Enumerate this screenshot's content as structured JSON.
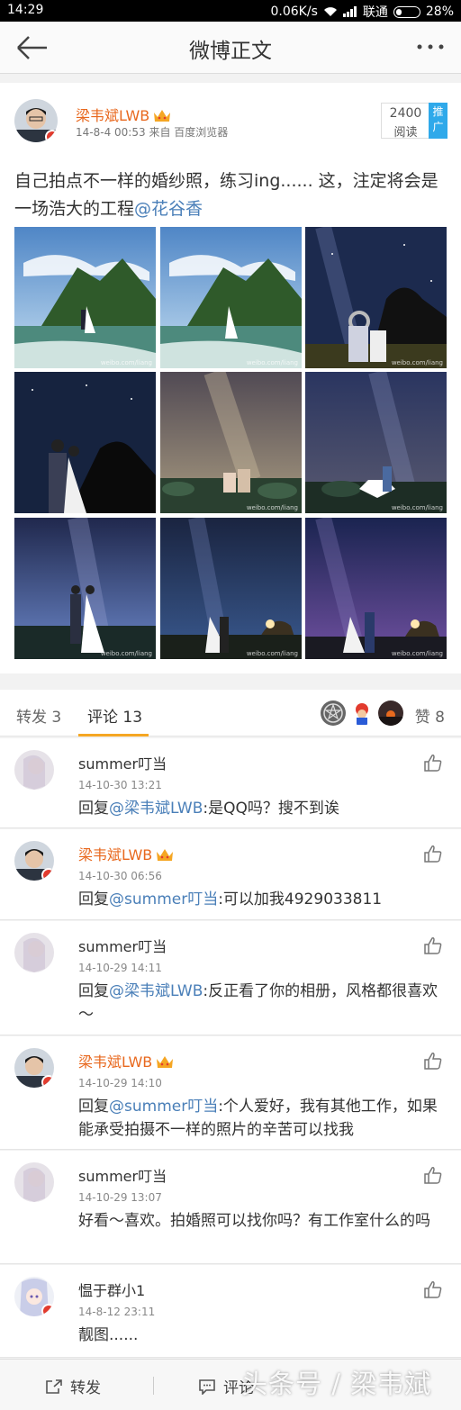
{
  "status": {
    "time": "14:29",
    "speed": "0.06K/s",
    "carrier": "联通",
    "battery": "28%",
    "battery_level": 0.28
  },
  "nav": {
    "title": "微博正文"
  },
  "post": {
    "author": "梁韦斌LWB",
    "datetime": "14-8-4 00:53",
    "source": "来自 百度浏览器",
    "read_count": "2400",
    "read_label": "阅读",
    "promo_label": "推广",
    "text": "自己拍点不一样的婚纱照，练习ing...... 这，注定将会是一场浩大的工程",
    "mention": "@花谷香",
    "photo_watermark": "weibo.com/liang"
  },
  "tabs": {
    "reposts": "转发 3",
    "comments": "评论 13",
    "likes": "赞 8"
  },
  "comments": [
    {
      "name": "summer叮当",
      "time": "14-10-30 13:21",
      "prefix": "回复",
      "mention": "@梁韦斌LWB",
      "text": ":是QQ吗？搜不到诶"
    },
    {
      "name": "梁韦斌LWB",
      "time": "14-10-30 06:56",
      "prefix": "回复",
      "mention": "@summer叮当",
      "text": ":可以加我4929033811"
    },
    {
      "name": "summer叮当",
      "time": "14-10-29 14:11",
      "prefix": "回复",
      "mention": "@梁韦斌LWB",
      "text": ":反正看了你的相册，风格都很喜欢～"
    },
    {
      "name": "梁韦斌LWB",
      "time": "14-10-29 14:10",
      "prefix": "回复",
      "mention": "@summer叮当",
      "text": ":个人爱好，我有其他工作，如果能承受拍摄不一样的照片的辛苦可以找我"
    },
    {
      "name": "summer叮当",
      "time": "14-10-29 13:07",
      "prefix": "",
      "mention": "",
      "text": "好看～喜欢。拍婚照可以找你吗？有工作室什么的吗"
    },
    {
      "name": "愠于群小1",
      "time": "14-8-12 23:11",
      "prefix": "",
      "mention": "",
      "text": "靓图......"
    }
  ],
  "bottom": {
    "repost": "转发",
    "comment": "评论",
    "watermark": "头条号 / 梁韦斌"
  },
  "colors": {
    "username_orange": "#e8681e",
    "mention_blue": "#4a7fb8",
    "tab_underline": "#f5a623",
    "promo_blue": "#2fa9ea",
    "verified_red": "#e23b2e"
  }
}
